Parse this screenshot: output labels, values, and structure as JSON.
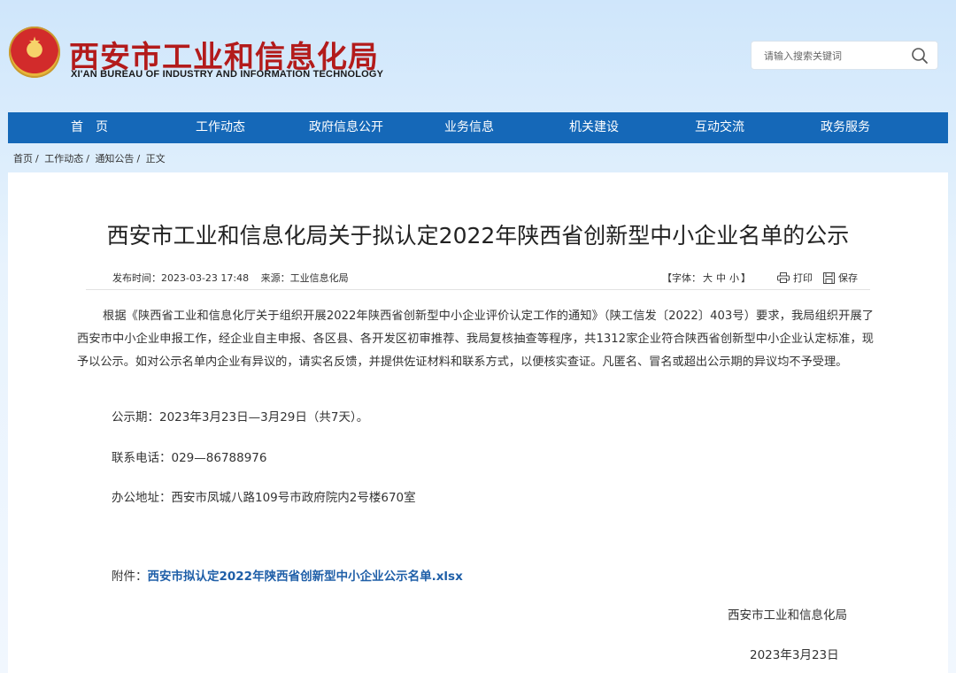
{
  "header": {
    "title": "西安市工业和信息化局",
    "subtitle": "XI'AN BUREAU OF INDUSTRY AND INFORMATION TECHNOLOGY",
    "emblem_icon": "national-emblem-icon"
  },
  "search": {
    "placeholder": "请输入搜索关键词",
    "icon": "search-icon"
  },
  "nav": {
    "items": [
      {
        "label": "首　页"
      },
      {
        "label": "工作动态"
      },
      {
        "label": "政府信息公开"
      },
      {
        "label": "业务信息"
      },
      {
        "label": "机关建设"
      },
      {
        "label": "互动交流"
      },
      {
        "label": "政务服务"
      }
    ]
  },
  "breadcrumb": {
    "items": [
      "首页",
      "工作动态",
      "通知公告",
      "正文"
    ],
    "separator": "/"
  },
  "article": {
    "title": "西安市工业和信息化局关于拟认定2022年陕西省创新型中小企业名单的公示",
    "publish_time_label": "发布时间：",
    "publish_time": "2023-03-23 17:48",
    "source_label": "来源：",
    "source": "工业信息化局",
    "font_label_open": "【字体：",
    "font_large": "大",
    "font_medium": "中",
    "font_small": "小",
    "font_label_close": "】",
    "print_label": "打印",
    "save_label": "保存",
    "paragraph": "根据《陕西省工业和信息化厅关于组织开展2022年陕西省创新型中小企业评价认定工作的通知》（陕工信发〔2022〕403号）要求，我局组织开展了西安市中小企业申报工作，经企业自主申报、各区县、各开发区初审推荐、我局复核抽查等程序，共1312家企业符合陕西省创新型中小企业认定标准，现予以公示。如对公示名单内企业有异议的，请实名反馈，并提供佐证材料和联系方式，以便核实查证。凡匿名、冒名或超出公示期的异议均不予受理。",
    "period": "公示期：2023年3月23日—3月29日（共7天）。",
    "phone": "联系电话：029—86788976",
    "address": "办公地址：西安市凤城八路109号市政府院内2号楼670室",
    "attachment_label": "附件：",
    "attachment_link": "西安市拟认定2022年陕西省创新型中小企业公示名单.xlsx",
    "signature": "西安市工业和信息化局",
    "date": "2023年3月23日"
  },
  "colors": {
    "nav_bg": "#1568b8",
    "title_red": "#b31b1b",
    "link_blue": "#1f5fa8"
  }
}
